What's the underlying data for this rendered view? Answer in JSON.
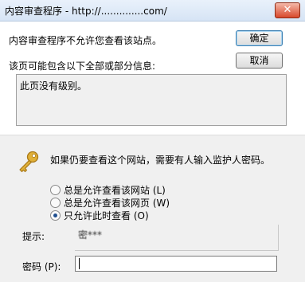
{
  "window": {
    "title": "内容审查程序 - http://..............com/",
    "close_label": "✕"
  },
  "dialog": {
    "message": "内容审查程序不允许您查看该站点。",
    "sub_message": "该页可能包含以下全部或部分信息:",
    "ok_label": "确定",
    "cancel_label": "取消",
    "details_text": "此页没有级别。"
  },
  "override": {
    "prompt": "如果仍要查看这个网站，需要有人输入监护人密码。",
    "options": [
      {
        "label": "总是允许查看该网站 (L)",
        "checked": false
      },
      {
        "label": "总是允许查看该网页 (W)",
        "checked": false
      },
      {
        "label": "只允许此时查看 (O)",
        "checked": true
      }
    ]
  },
  "hint": {
    "label": "提示:",
    "value": "密***"
  },
  "password": {
    "label": "密码 (P):",
    "value": ""
  },
  "icons": {
    "key": "key-icon",
    "close": "close-icon"
  },
  "colors": {
    "key": "#d9a628",
    "titlebar": "#dbe6f4",
    "client": "#f0f0f0"
  }
}
